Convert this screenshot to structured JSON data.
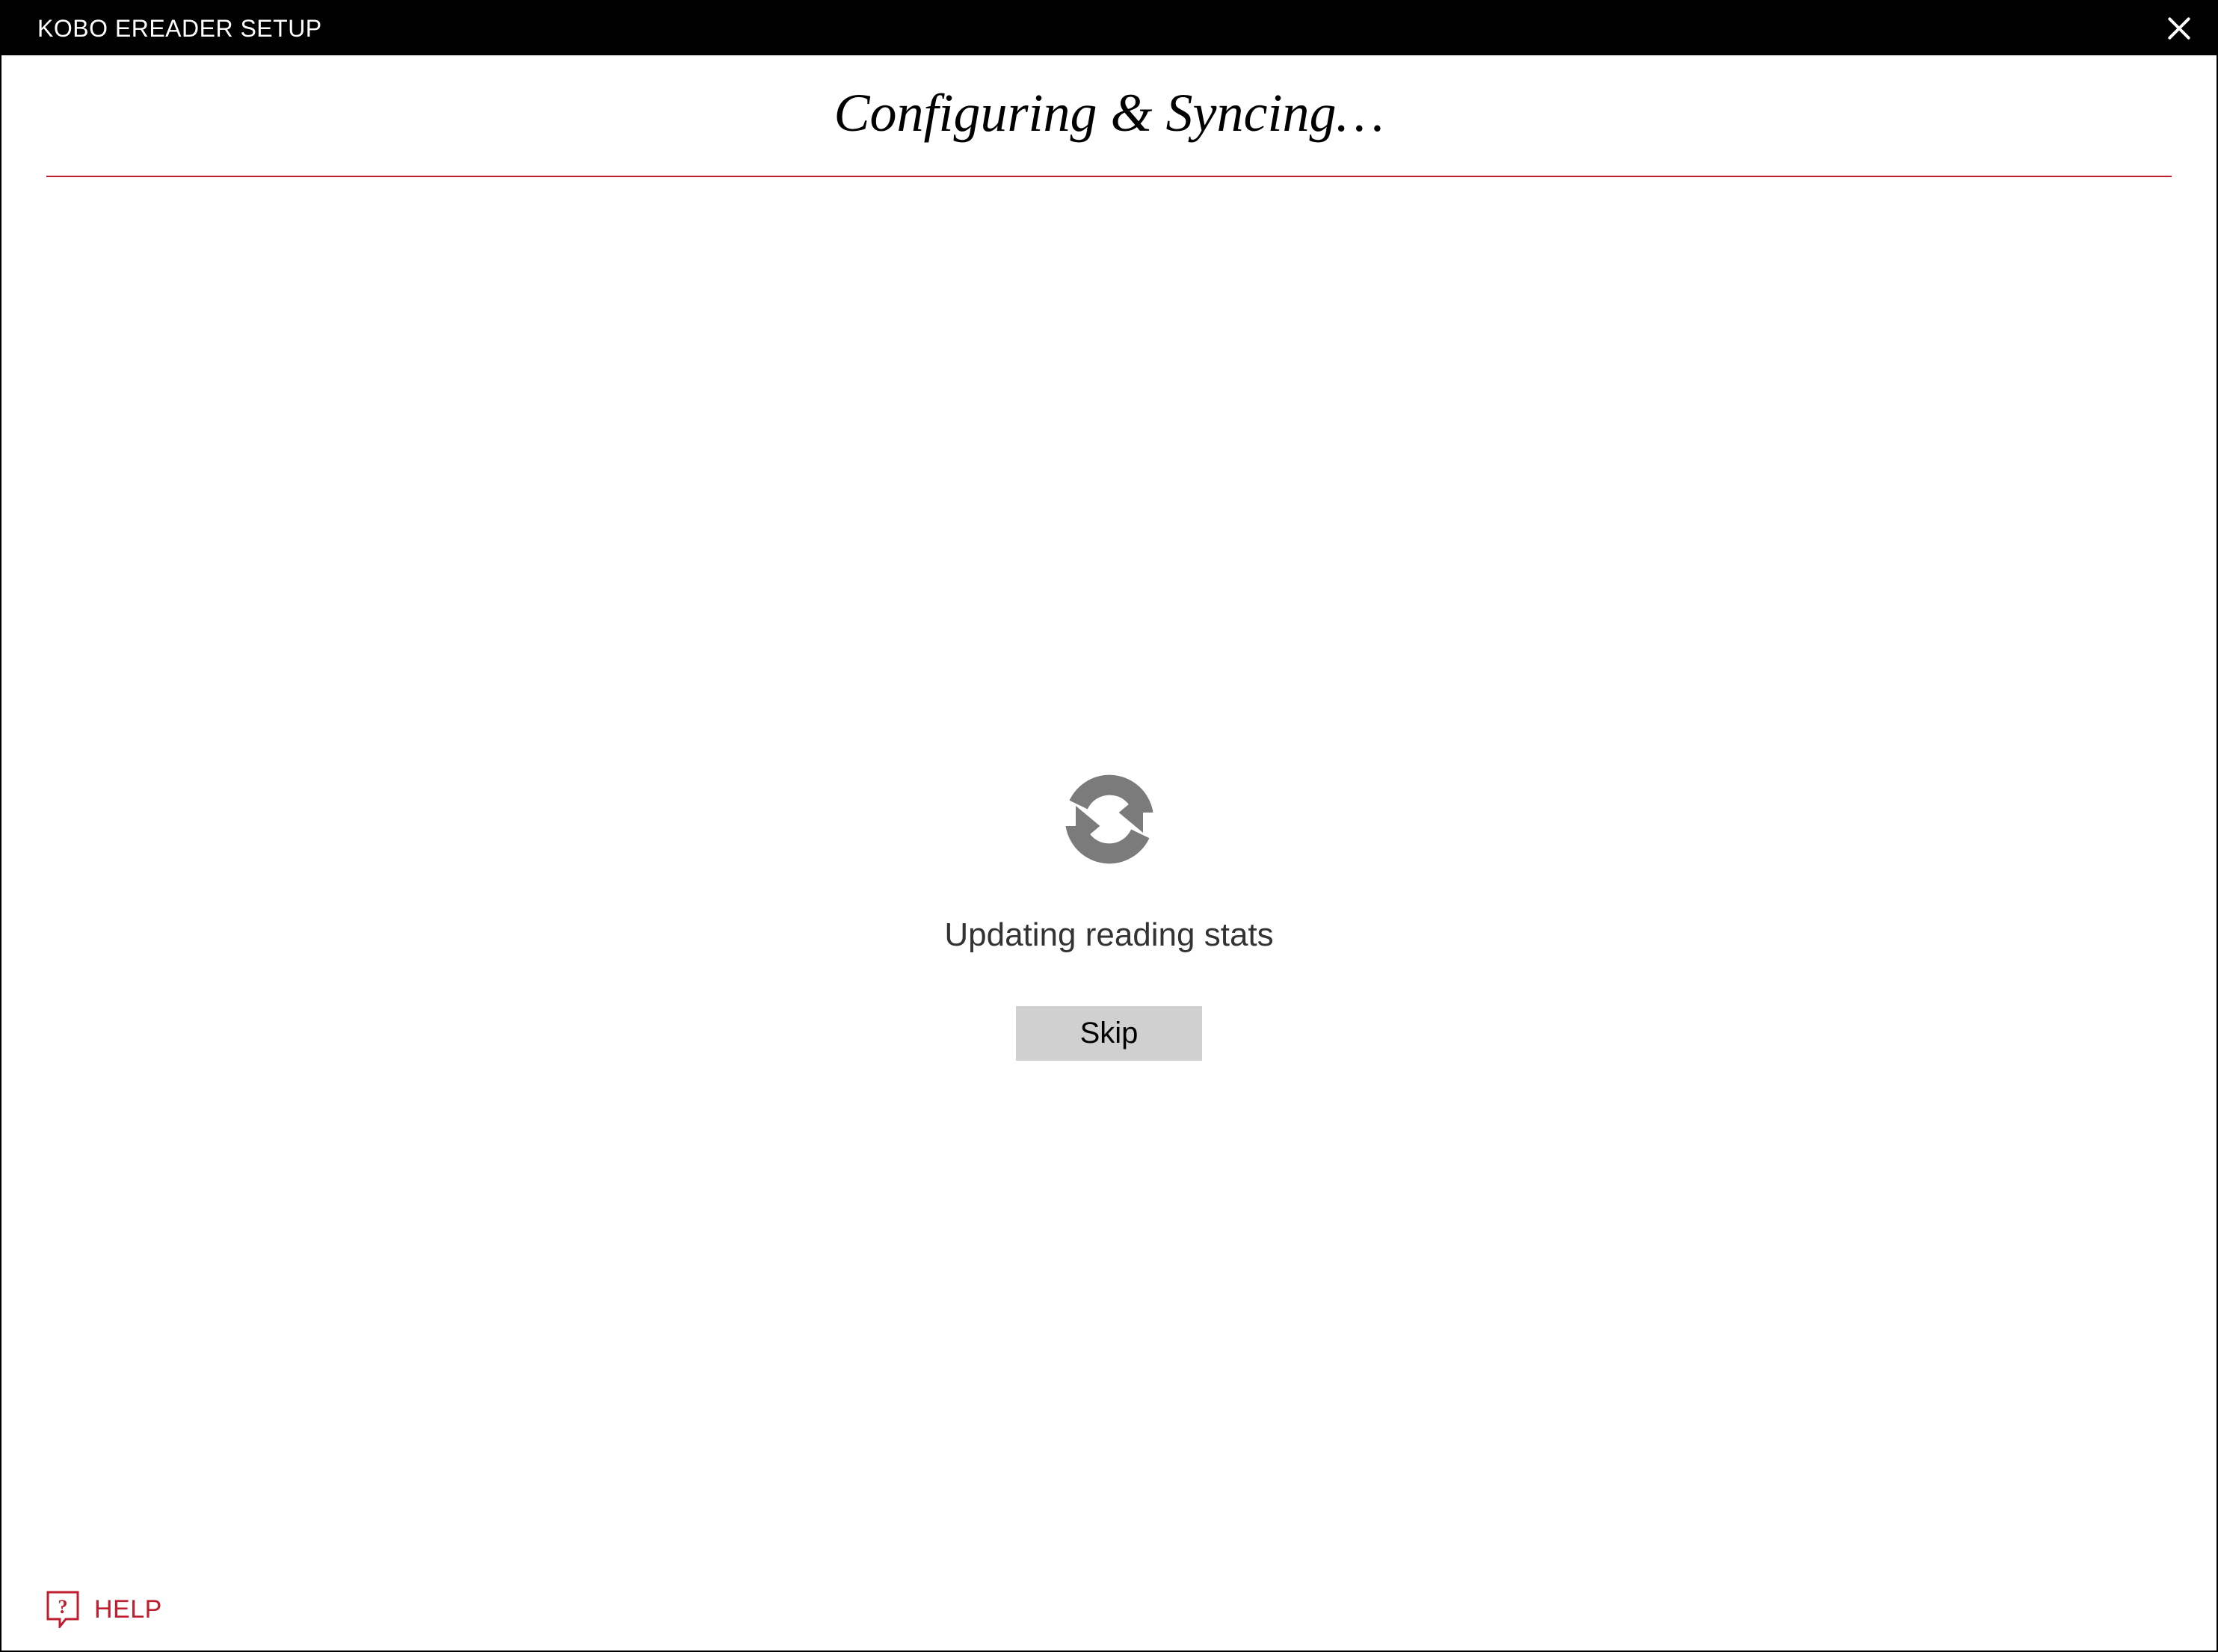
{
  "titlebar": {
    "title": "KOBO EREADER SETUP"
  },
  "main": {
    "heading": "Configuring & Syncing…",
    "status_text": "Updating reading stats",
    "skip_label": "Skip"
  },
  "footer": {
    "help_label": "HELP"
  },
  "colors": {
    "accent": "#be1e2d",
    "titlebar_bg": "#000000",
    "button_bg": "#d0d0d0",
    "icon_gray": "#7b7b7b"
  }
}
